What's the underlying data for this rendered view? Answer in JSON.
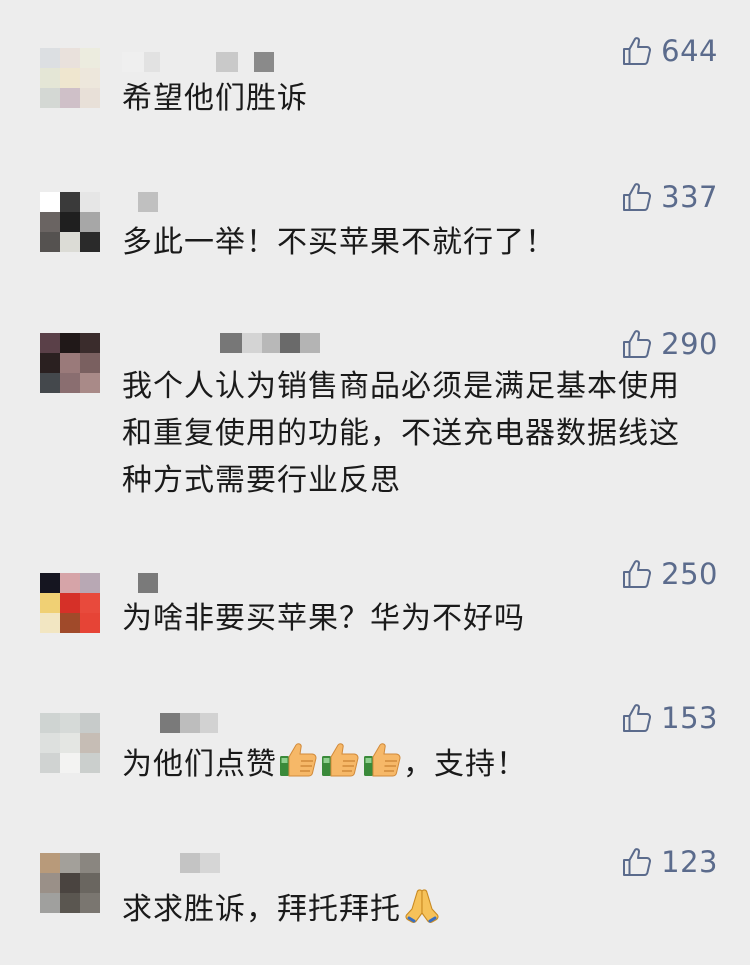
{
  "comments": [
    {
      "likes": "644",
      "text": "希望他们胜诉"
    },
    {
      "likes": "337",
      "text": "多此一举！不买苹果不就行了！"
    },
    {
      "likes": "290",
      "text": "我个人认为销售商品必须是满足基本使用和重复使用的功能，不送充电器数据线这种方式需要行业反思"
    },
    {
      "likes": "250",
      "text": "为啥非要买苹果？华为不好吗"
    },
    {
      "likes": "153",
      "text_before": "为他们点赞",
      "text_after": "，支持！",
      "emoji": [
        "thumbs-up",
        "thumbs-up",
        "thumbs-up"
      ]
    },
    {
      "likes": "123",
      "text_before": "求求胜诉，拜托拜托",
      "emoji": [
        "folded-hands"
      ]
    }
  ],
  "colors": {
    "background": "#ededed",
    "like_color": "#5b6b8c",
    "text_color": "#1a1a1a"
  }
}
